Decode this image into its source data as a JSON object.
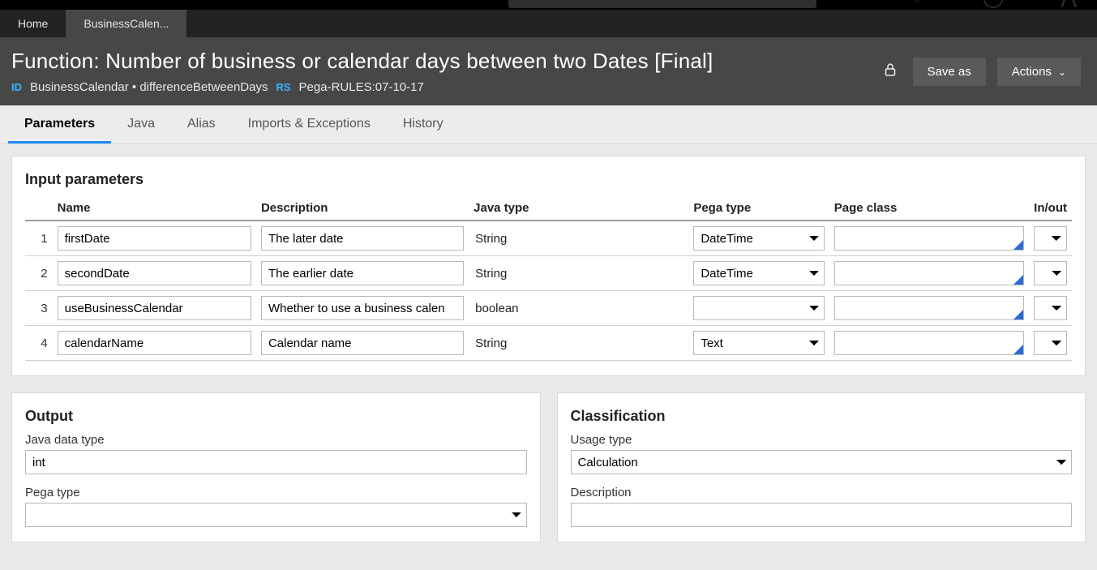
{
  "app_tabs": {
    "home": "Home",
    "current": "BusinessCalen..."
  },
  "rule": {
    "title": "Function: Number of business or calendar days between two Dates [Final]",
    "id_label": "ID",
    "id_value": "BusinessCalendar • differenceBetweenDays",
    "rs_label": "RS",
    "rs_value": "Pega-RULES:07-10-17"
  },
  "buttons": {
    "save_as": "Save as",
    "actions": "Actions"
  },
  "subtabs": {
    "parameters": "Parameters",
    "java": "Java",
    "alias": "Alias",
    "imports": "Imports & Exceptions",
    "history": "History"
  },
  "input_params": {
    "heading": "Input parameters",
    "cols": {
      "name": "Name",
      "desc": "Description",
      "java": "Java type",
      "pega": "Pega type",
      "page": "Page class",
      "io": "In/out"
    },
    "rows": [
      {
        "n": "1",
        "name": "firstDate",
        "desc": "The later date",
        "java": "String",
        "pega": "DateTime",
        "page": "",
        "io": ""
      },
      {
        "n": "2",
        "name": "secondDate",
        "desc": "The earlier date",
        "java": "String",
        "pega": "DateTime",
        "page": "",
        "io": ""
      },
      {
        "n": "3",
        "name": "useBusinessCalendar",
        "desc": "Whether to use a business calen",
        "java": "boolean",
        "pega": "",
        "page": "",
        "io": ""
      },
      {
        "n": "4",
        "name": "calendarName",
        "desc": "Calendar name",
        "java": "String",
        "pega": "Text",
        "page": "",
        "io": ""
      }
    ]
  },
  "output": {
    "heading": "Output",
    "java_label": "Java data type",
    "java_value": "int",
    "pega_label": "Pega type",
    "pega_value": ""
  },
  "classification": {
    "heading": "Classification",
    "usage_label": "Usage type",
    "usage_value": "Calculation",
    "desc_label": "Description",
    "desc_value": ""
  }
}
